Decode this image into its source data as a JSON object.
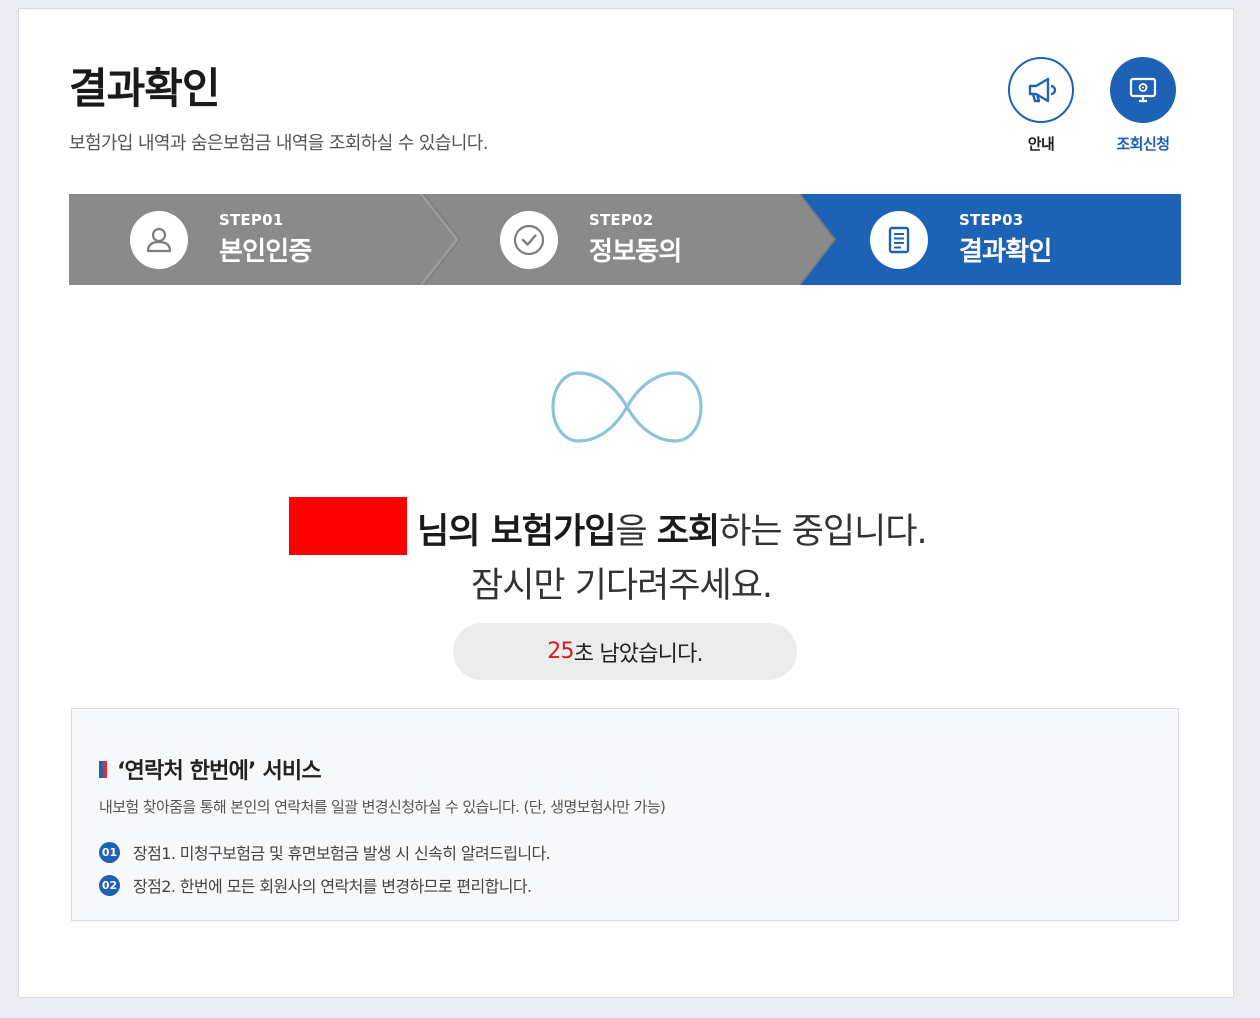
{
  "header": {
    "title": "결과확인",
    "description": "보험가입 내역과 숨은보험금 내역을 조회하실 수 있습니다.",
    "buttons": {
      "guide_label": "안내",
      "apply_label": "조회신청"
    }
  },
  "steps": [
    {
      "num": "STEP01",
      "name": "본인인증",
      "icon": "person-icon",
      "active": false
    },
    {
      "num": "STEP02",
      "name": "정보동의",
      "icon": "check-circle-icon",
      "active": false
    },
    {
      "num": "STEP03",
      "name": "결과확인",
      "icon": "document-icon",
      "active": true
    }
  ],
  "waiting": {
    "line1_suffix_a": "님의 ",
    "line1_bold_a": "보험가입",
    "line1_mid": "을 ",
    "line1_bold_b": "조회",
    "line1_end": "하는 중입니다.",
    "line2": "잠시만 기다려주세요.",
    "seconds": "25",
    "timer_text": "초 남았습니다."
  },
  "service": {
    "title": "‘연락처 한번에’ 서비스",
    "description": "내보험 찾아줌을 통해 본인의 연락처를 일괄 변경신청하실 수 있습니다. (단, 생명보험사만 가능)",
    "items": [
      {
        "badge": "01",
        "text": "장점1. 미청구보험금 및 휴면보험금 발생 시 신속히 알려드립니다."
      },
      {
        "badge": "02",
        "text": "장점2. 한번에 모든 회원사의 연락처를 변경하므로 편리합니다."
      }
    ]
  },
  "colors": {
    "accent": "#1e62b6",
    "step_inactive": "#8a8a8a",
    "timer_seconds": "#d71920",
    "redaction": "#ff0000"
  }
}
